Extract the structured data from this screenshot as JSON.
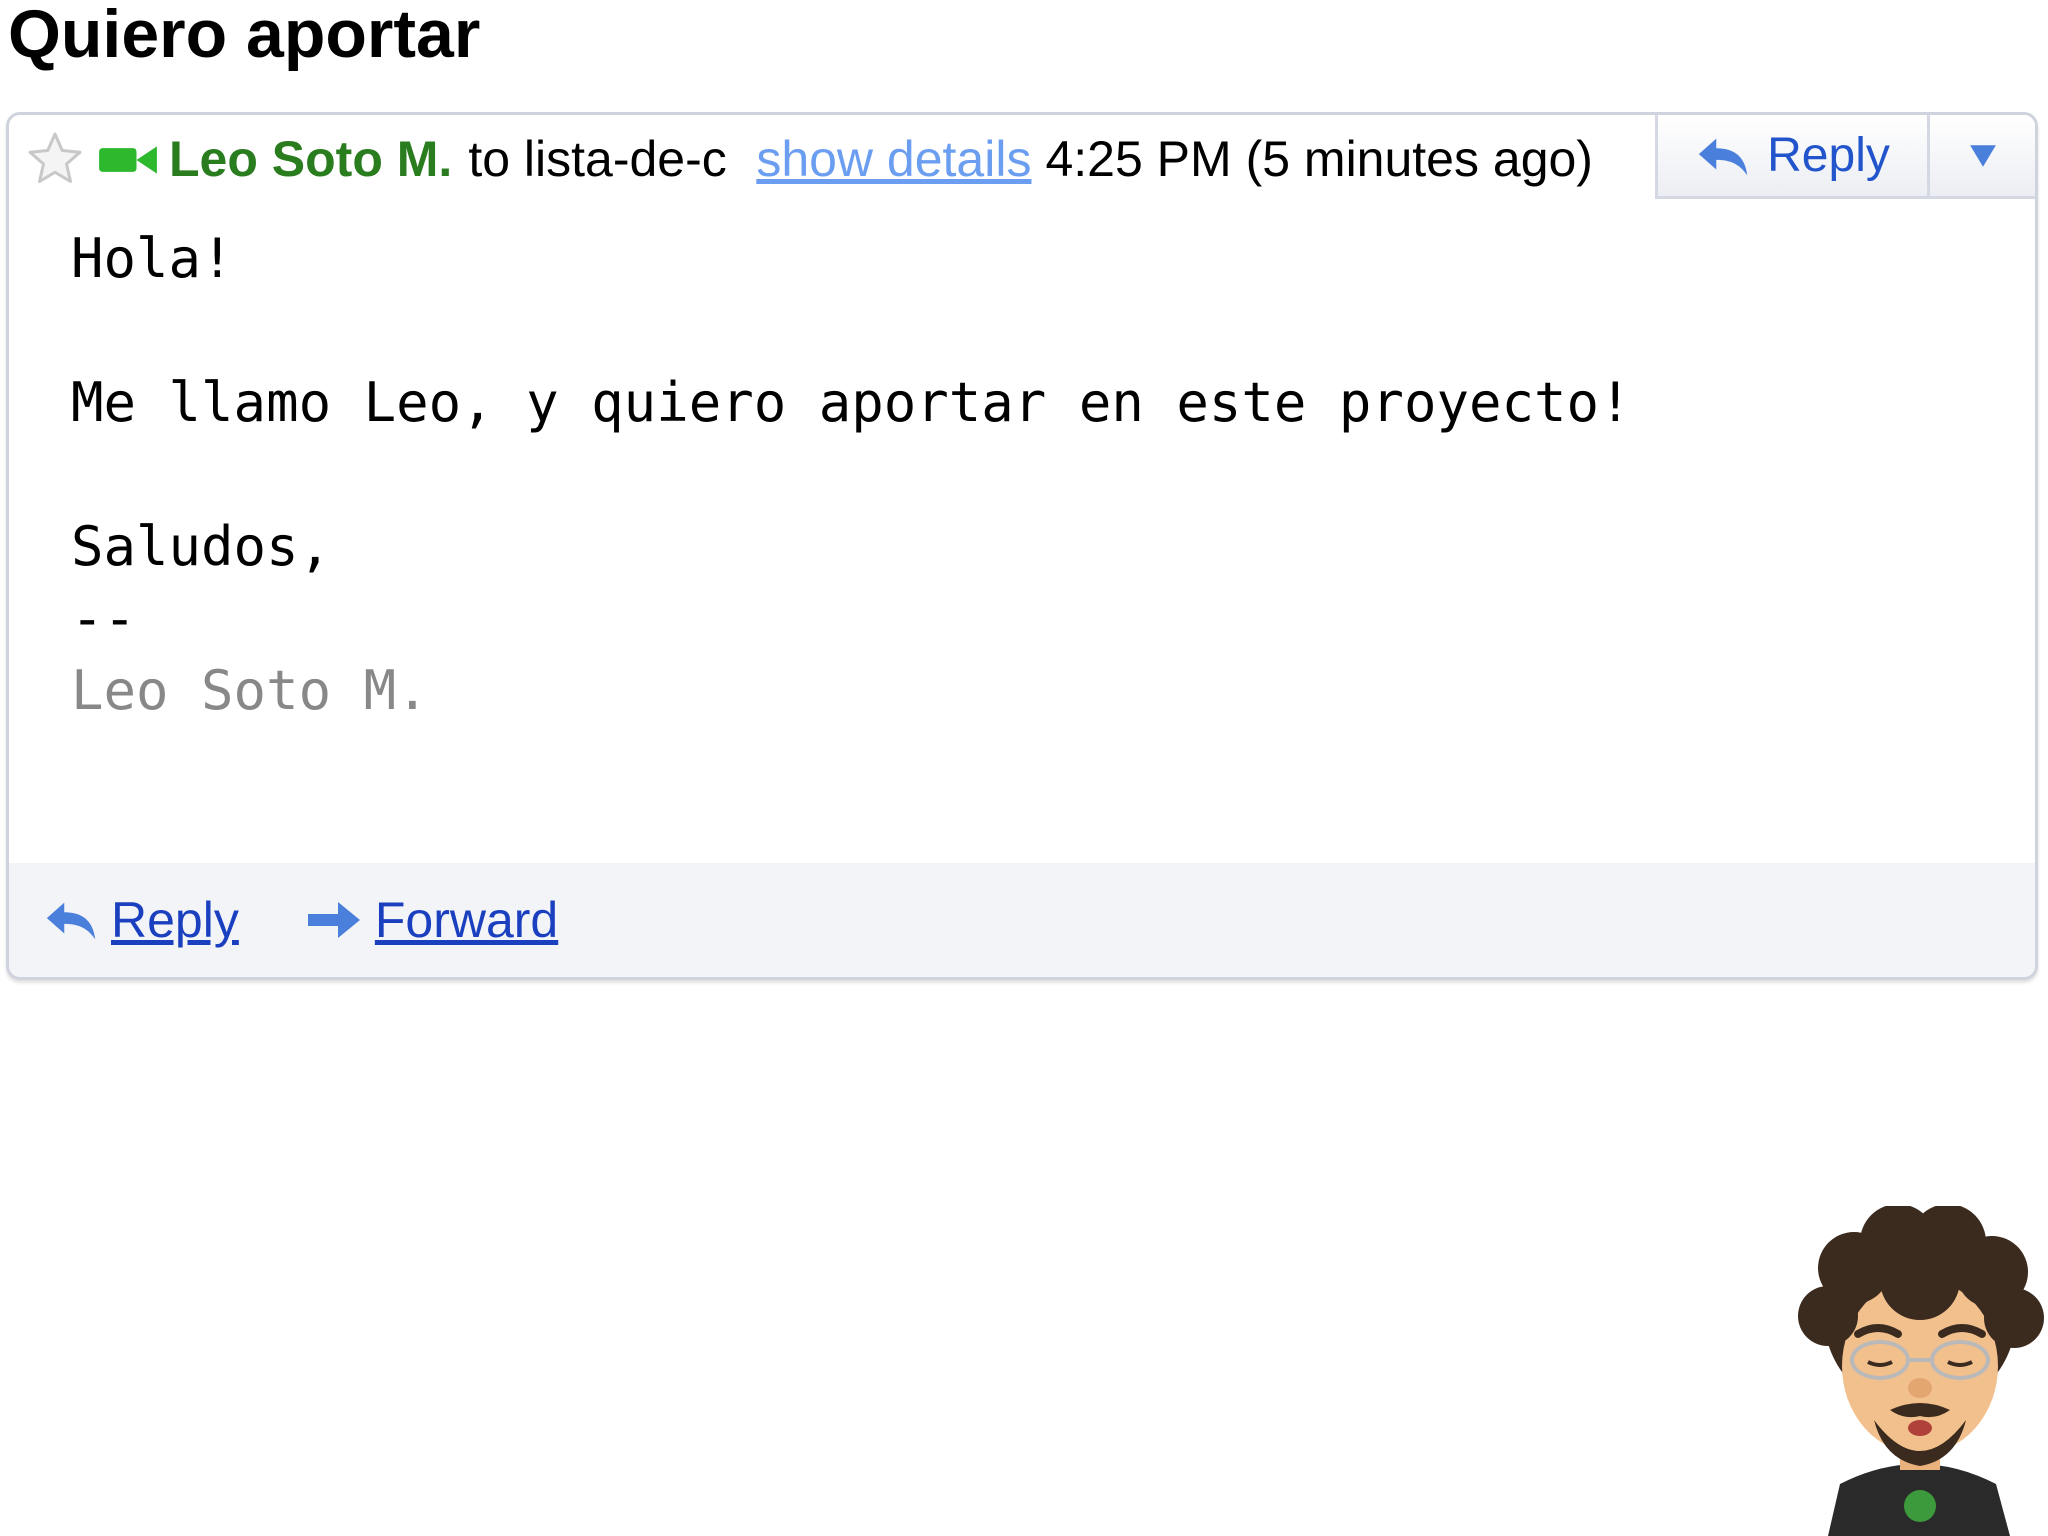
{
  "subject": "Quiero aportar",
  "header": {
    "sender_name": "Leo Soto M.",
    "recipient": "to lista-de-c",
    "show_details": "show details",
    "timestamp": "4:25 PM (5 minutes ago)",
    "reply_label": "Reply"
  },
  "body": {
    "lines": [
      "Hola!",
      "",
      "Me llamo Leo, y quiero aportar en este proyecto!",
      "",
      "Saludos,",
      "--",
      "Leo Soto M."
    ]
  },
  "footer": {
    "reply_label": "Reply",
    "forward_label": "Forward"
  },
  "icons": {
    "star": "star-icon",
    "video": "video-chat-icon",
    "reply": "reply-arrow-icon",
    "forward": "forward-arrow-icon",
    "dropdown": "dropdown-triangle-icon"
  },
  "colors": {
    "sender": "#2a7d1f",
    "link": "#1a3fbf",
    "show_details": "#6b9ef0",
    "signature": "#888888",
    "reply_icon": "#4a7fdc"
  }
}
